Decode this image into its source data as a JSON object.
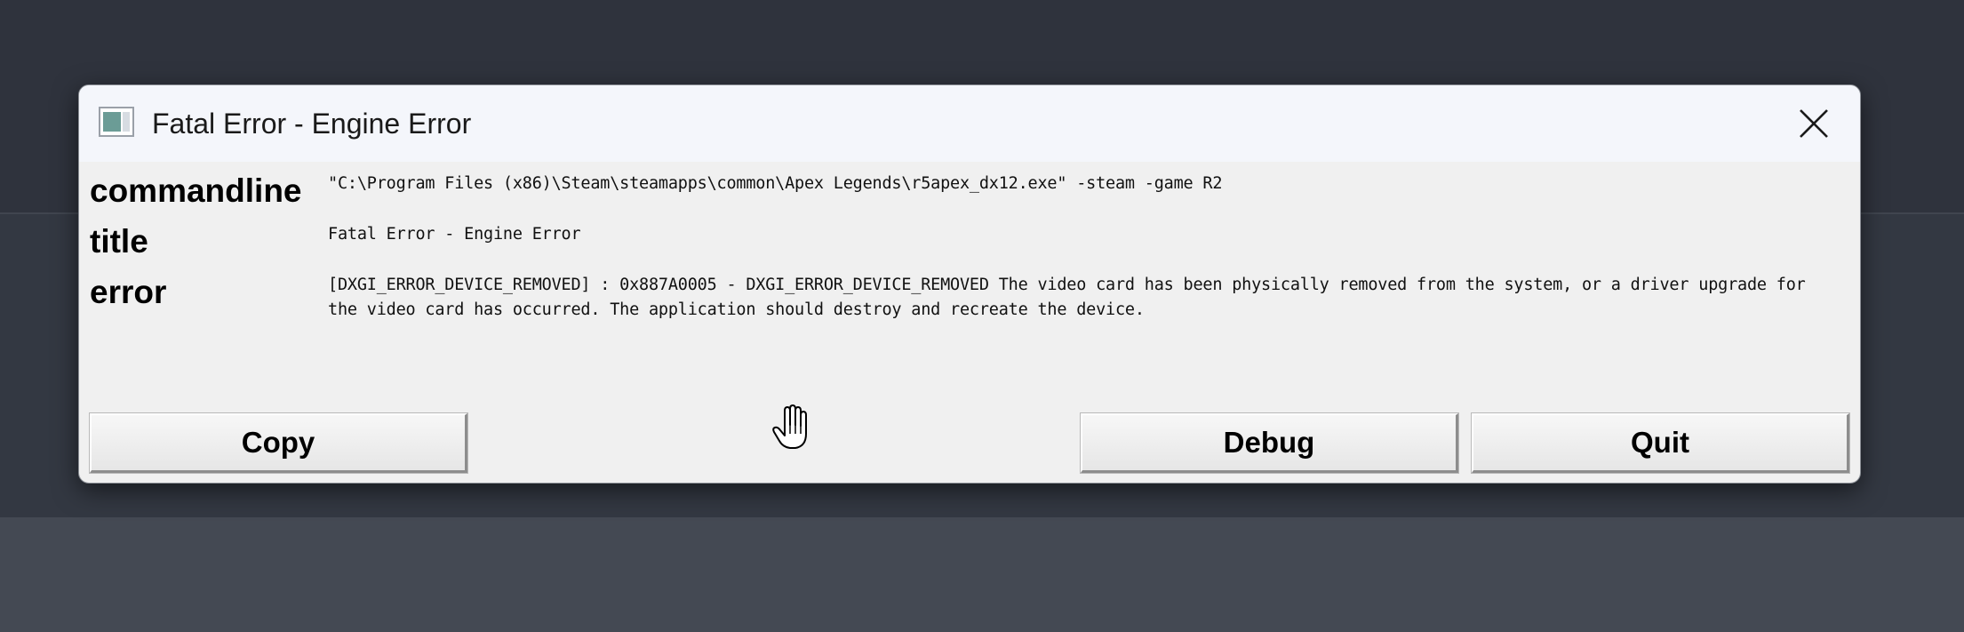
{
  "dialog": {
    "title": "Fatal Error - Engine Error",
    "close_icon": "close-icon",
    "app_icon": "app-window-icon"
  },
  "fields": [
    {
      "label": "commandline",
      "value": "\"C:\\Program Files (x86)\\Steam\\steamapps\\common\\Apex Legends\\r5apex_dx12.exe\" -steam -game R2"
    },
    {
      "label": "title",
      "value": "Fatal Error - Engine Error"
    },
    {
      "label": "error",
      "value": "[DXGI_ERROR_DEVICE_REMOVED] : 0x887A0005 - DXGI_ERROR_DEVICE_REMOVED The video card has been physically removed from the system, or a driver upgrade for the video card has occurred. The application should destroy and recreate the device."
    }
  ],
  "buttons": {
    "copy": "Copy",
    "debug": "Debug",
    "quit": "Quit"
  },
  "cursor_icon": "hand-cursor-icon",
  "colors": {
    "background": "#2f333d",
    "dialog": "#f0f0f0",
    "titlebar": "#f4f6fb"
  }
}
